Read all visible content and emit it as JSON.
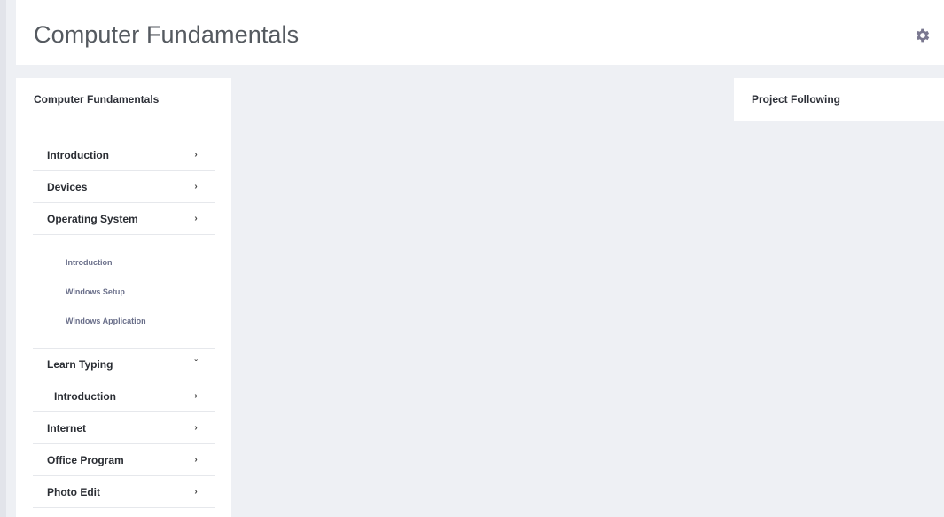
{
  "header": {
    "title": "Computer Fundamentals",
    "settings_icon": "gear-icon"
  },
  "sidebar": {
    "title": "Computer Fundamentals",
    "items": [
      {
        "label": "Introduction",
        "icon": "chevron-right-icon"
      },
      {
        "label": "Devices",
        "icon": "chevron-right-icon"
      },
      {
        "label": "Operating System",
        "icon": "chevron-right-icon"
      }
    ],
    "os_submenu": [
      "Introduction",
      "Windows Setup",
      "Windows Application"
    ],
    "learn_typing": {
      "label": "Learn Typing",
      "icon": "chevron-down-icon"
    },
    "learn_typing_child": {
      "label": "Introduction",
      "icon": "chevron-right-icon"
    },
    "items_after": [
      {
        "label": "Internet",
        "icon": "chevron-right-icon"
      },
      {
        "label": "Office Program",
        "icon": "chevron-right-icon"
      },
      {
        "label": "Photo Edit",
        "icon": "chevron-right-icon"
      }
    ]
  },
  "right_panel": {
    "title": "Project Following"
  },
  "colors": {
    "background": "#eef0f4",
    "card": "#ffffff",
    "submenu_text": "#6a6f8a",
    "gear": "#7a7890"
  }
}
